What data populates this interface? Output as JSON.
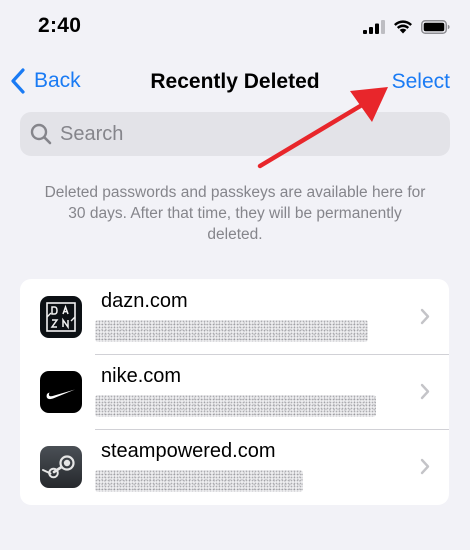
{
  "status": {
    "time": "2:40"
  },
  "nav": {
    "back_label": "Back",
    "title": "Recently Deleted",
    "select_label": "Select"
  },
  "search": {
    "placeholder": "Search"
  },
  "info": {
    "text": "Deleted passwords and passkeys are available here for 30 days. After that time, they will be permanently deleted."
  },
  "entries": [
    {
      "site": "dazn.com",
      "icon": "dazn-logo-icon"
    },
    {
      "site": "nike.com",
      "icon": "nike-logo-icon"
    },
    {
      "site": "steampowered.com",
      "icon": "steam-logo-icon"
    }
  ],
  "colors": {
    "accent": "#1A7BF4",
    "background": "#F2F2F7",
    "annotation_arrow": "#E8262B"
  }
}
